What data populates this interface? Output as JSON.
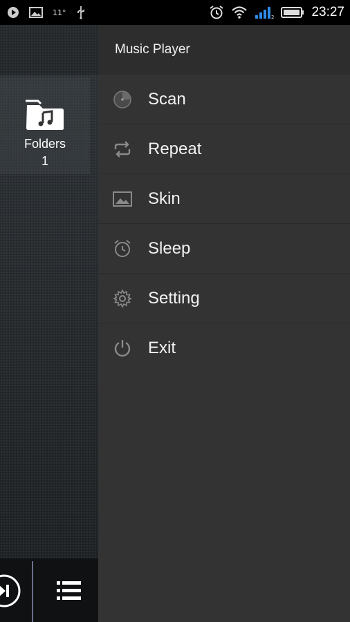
{
  "status_bar": {
    "temperature": "11°",
    "time": "23:27",
    "left_icons": [
      "play-circle-icon",
      "image-icon",
      "usb-icon"
    ],
    "right_icons": [
      "alarm-icon",
      "wifi-icon",
      "signal-icon",
      "battery-icon"
    ],
    "signal_color": "#2f8be6"
  },
  "library": {
    "folders": {
      "label": "Folders",
      "count": "1"
    }
  },
  "player_controls": {
    "buttons": [
      "next-track-icon",
      "queue-list-icon"
    ]
  },
  "drawer": {
    "title": "Music Player",
    "items": [
      {
        "label": "Scan",
        "icon": "scan-icon"
      },
      {
        "label": "Repeat",
        "icon": "repeat-icon"
      },
      {
        "label": "Skin",
        "icon": "image-icon"
      },
      {
        "label": "Sleep",
        "icon": "alarm-clock-icon"
      },
      {
        "label": "Setting",
        "icon": "gear-icon"
      },
      {
        "label": "Exit",
        "icon": "power-icon"
      }
    ]
  }
}
